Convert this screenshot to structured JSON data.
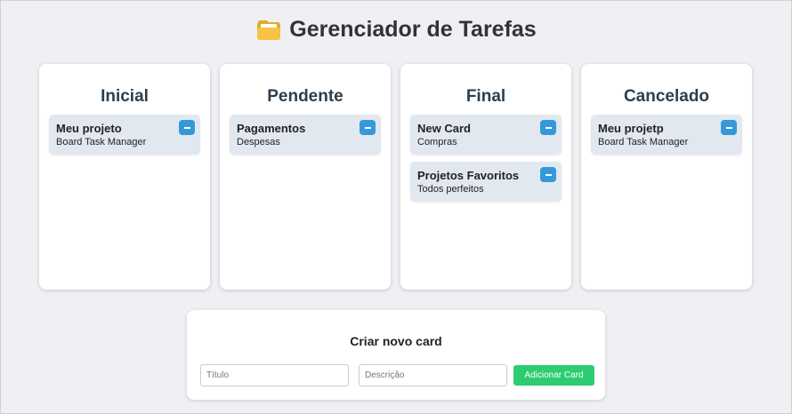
{
  "header": {
    "icon": "folder-icon",
    "title": "Gerenciador de Tarefas"
  },
  "columns": [
    {
      "title": "Inicial",
      "cards": [
        {
          "title": "Meu projeto",
          "description": "Board Task Manager"
        }
      ]
    },
    {
      "title": "Pendente",
      "cards": [
        {
          "title": "Pagamentos",
          "description": "Despesas"
        }
      ]
    },
    {
      "title": "Final",
      "cards": [
        {
          "title": "New Card",
          "description": "Compras"
        },
        {
          "title": "Projetos Favoritos",
          "description": "Todos perfeitos"
        }
      ]
    },
    {
      "title": "Cancelado",
      "cards": [
        {
          "title": "Meu projetp",
          "description": "Board Task Manager"
        }
      ]
    }
  ],
  "new_card_form": {
    "heading": "Criar novo card",
    "title_placeholder": "Título",
    "description_placeholder": "Descrição",
    "submit_label": "Adicionar Card"
  },
  "colors": {
    "remove_button": "#3498db",
    "add_button": "#2ecc71",
    "card_background": "#e2e8f0",
    "column_heading": "#2c3e50"
  }
}
